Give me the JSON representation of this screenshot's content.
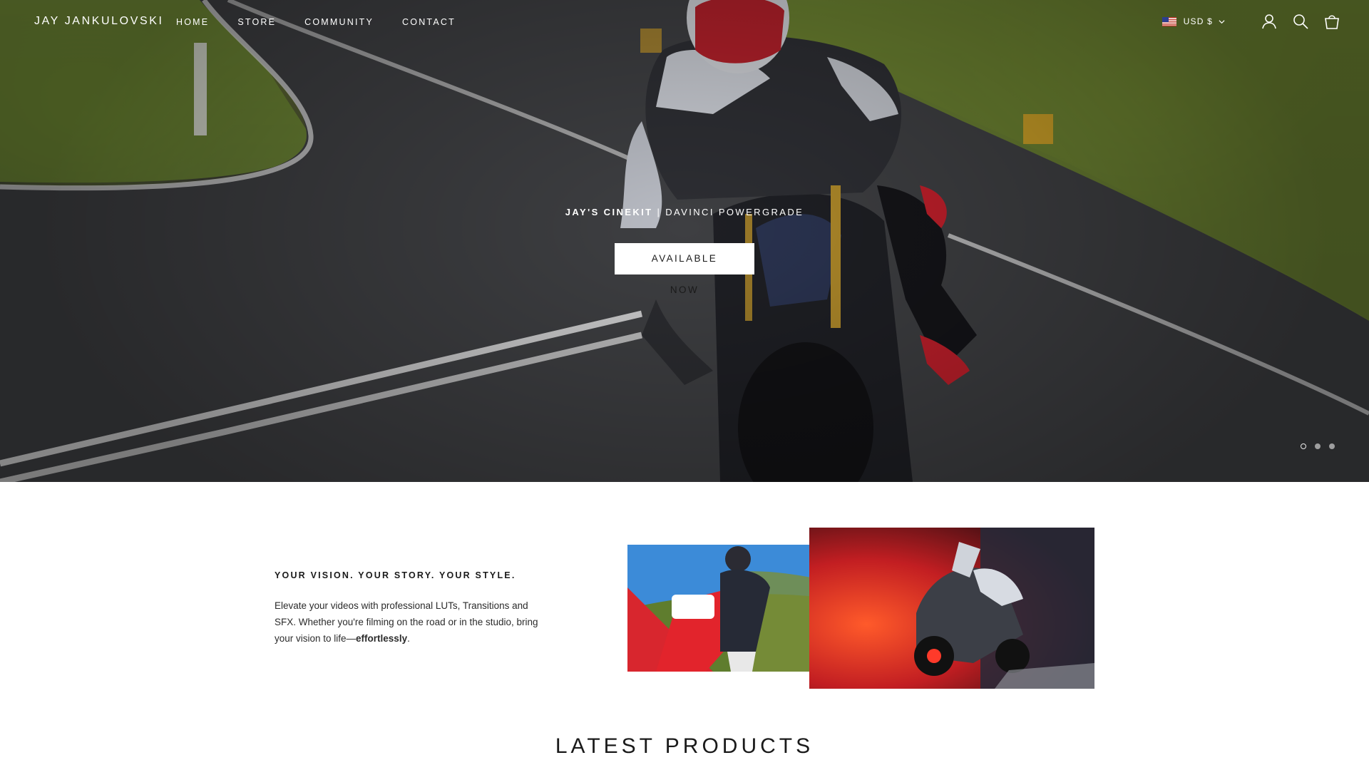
{
  "header": {
    "logo": "JAY JANKULOVSKI",
    "nav": [
      "HOME",
      "STORE",
      "COMMUNITY",
      "CONTACT"
    ],
    "currency": "USD $",
    "icons": [
      "us-flag-icon",
      "chevron-down-icon",
      "account-icon",
      "search-icon",
      "cart-icon"
    ]
  },
  "hero": {
    "tag_strong": "JAY'S CINEKIT",
    "tag_rest": " | DAVINCI POWERGRADE",
    "button": "AVAILABLE NOW",
    "slides": 3,
    "active_slide": 1
  },
  "intro": {
    "heading": "YOUR VISION. YOUR STORY. YOUR STYLE.",
    "body_before": "Elevate your videos with professional LUTs, Transitions and SFX. Whether you're filming on the road or in the studio, bring your vision to life—",
    "body_bold": "effortlessly",
    "body_after": "."
  },
  "latest": {
    "title": "LATEST PRODUCTS"
  },
  "colors": {
    "text": "#1a1a1a",
    "white": "#ffffff",
    "accent_red": "#d9262c"
  }
}
